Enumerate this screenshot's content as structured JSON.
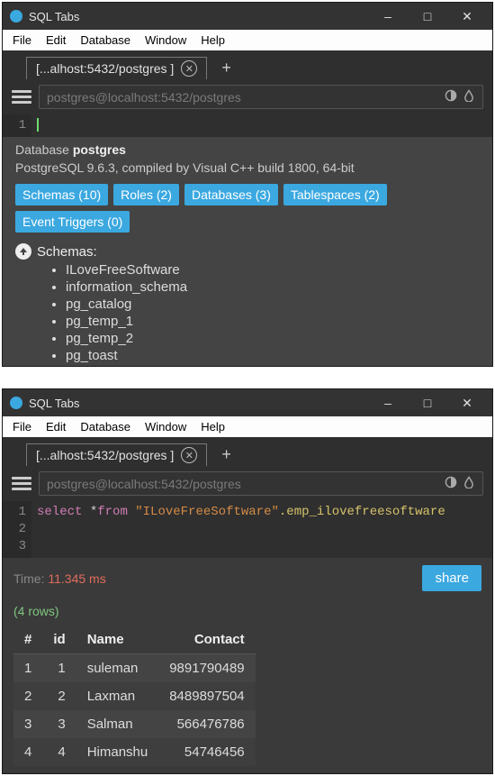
{
  "app": {
    "title": "SQL Tabs"
  },
  "menus": [
    "File",
    "Edit",
    "Database",
    "Window",
    "Help"
  ],
  "tab": {
    "label": "[...alhost:5432/postgres ]"
  },
  "addr": {
    "placeholder": "postgres@localhost:5432/postgres"
  },
  "win1": {
    "editor_lines": [
      "1"
    ],
    "db_label": "Database",
    "db_name": "postgres",
    "version": "PostgreSQL 9.6.3, compiled by Visual C++ build 1800, 64-bit",
    "badges": [
      "Schemas (10)",
      "Roles (2)",
      "Databases (3)",
      "Tablespaces (2)",
      "Event Triggers (0)"
    ],
    "schemas_heading": "Schemas:",
    "schemas": [
      "ILoveFreeSoftware",
      "information_schema",
      "pg_catalog",
      "pg_temp_1",
      "pg_temp_2",
      "pg_toast"
    ]
  },
  "win2": {
    "editor_lines": [
      "1",
      "2",
      "3"
    ],
    "sql": {
      "kw1": "select",
      "star": " *",
      "kw2": "from",
      "str": "\"ILoveFreeSoftware\"",
      "rest": ".emp_ilovefreesoftware"
    },
    "time_label": "Time:",
    "time_value": "11.345 ms",
    "share": "share",
    "rowcount": "(4 rows)",
    "columns": [
      "#",
      "id",
      "Name",
      "Contact"
    ],
    "rows": [
      [
        "1",
        "1",
        "suleman",
        "9891790489"
      ],
      [
        "2",
        "2",
        "Laxman",
        "8489897504"
      ],
      [
        "3",
        "3",
        "Salman",
        "566476786"
      ],
      [
        "4",
        "4",
        "Himanshu",
        "54746456"
      ]
    ]
  }
}
